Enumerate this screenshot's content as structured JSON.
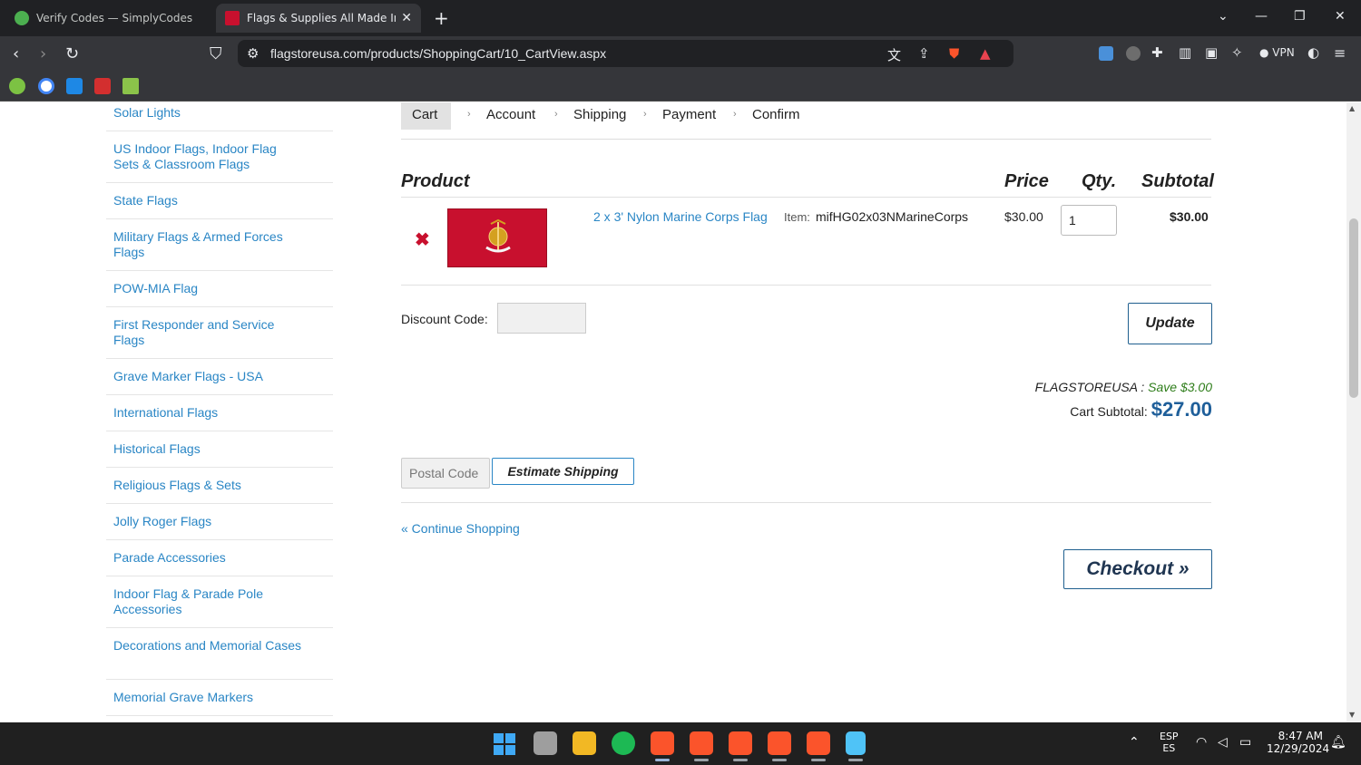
{
  "browser": {
    "tabs": [
      {
        "label": "Verify Codes — SimplyCodes",
        "active": false
      },
      {
        "label": "Flags & Supplies All Made In A",
        "active": true
      }
    ],
    "url": "flagstoreusa.com/products/ShoppingCart/10_CartView.aspx",
    "vpn_label": "VPN"
  },
  "sidebar": {
    "items": [
      "Solar Lights",
      "US Indoor Flags, Indoor Flag Sets & Classroom Flags",
      "State Flags",
      "Military Flags & Armed Forces Flags",
      "POW-MIA Flag",
      "First Responder and Service Flags",
      "Grave Marker Flags - USA",
      "International Flags",
      "Historical Flags",
      "Religious Flags & Sets",
      "Jolly Roger Flags",
      "Parade Accessories",
      "Indoor Flag & Parade Pole Accessories",
      "Decorations and Memorial Cases",
      "Memorial Grave Markers"
    ]
  },
  "checkout_steps": [
    "Cart",
    "Account",
    "Shipping",
    "Payment",
    "Confirm"
  ],
  "cart": {
    "headers": {
      "product": "Product",
      "price": "Price",
      "qty": "Qty.",
      "subtotal": "Subtotal"
    },
    "items": [
      {
        "name": "2 x 3' Nylon Marine Corps Flag",
        "item_label": "Item:",
        "item_code": "mifHG02x03NMarineCorps",
        "price": "$30.00",
        "qty": "1",
        "subtotal": "$30.00"
      }
    ],
    "discount_label": "Discount Code:",
    "update_label": "Update",
    "coupon_code": "FLAGSTOREUSA",
    "coupon_separator": " : ",
    "coupon_savings": "Save $3.00",
    "cart_subtotal_label": "Cart Subtotal:",
    "cart_subtotal_value": "$27.00",
    "postal_placeholder": "Postal Code",
    "estimate_label": "Estimate Shipping",
    "continue_label": "« Continue Shopping",
    "checkout_label": "Checkout »"
  },
  "taskbar": {
    "lang_top": "ESP",
    "lang_bottom": "ES",
    "time": "8:47 AM",
    "date": "12/29/2024"
  },
  "colors": {
    "link": "#2a86c5",
    "accent": "#1f5f9a",
    "remove": "#c8102e",
    "save": "#2e7d1a"
  }
}
